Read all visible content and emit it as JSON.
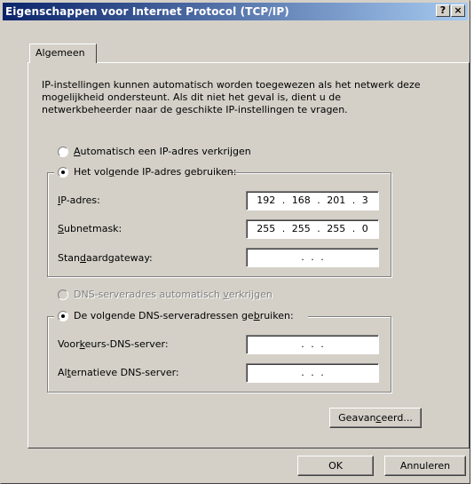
{
  "window": {
    "title": "Eigenschappen voor Internet Protocol (TCP/IP)",
    "help_button": "?",
    "close_button": "×"
  },
  "tabs": [
    {
      "label": "Algemeen",
      "selected": true
    }
  ],
  "description": "IP-instellingen kunnen automatisch worden toegewezen als het netwerk deze mogelijkheid ondersteunt. Als dit niet het geval is, dient u de netwerkbeheerder naar de geschikte IP-instellingen te vragen.",
  "ip_section": {
    "auto_option": {
      "label_pre": "",
      "label_key": "A",
      "label_post": "utomatisch een IP-adres verkrijgen",
      "selected": false
    },
    "manual_option": {
      "label_pre": "Het vol",
      "label_key": "g",
      "label_post": "ende IP-adres gebruiken:",
      "selected": true
    },
    "fields": [
      {
        "label_pre": "",
        "label_key": "I",
        "label_post": "P-adres:",
        "value": "192 . 168 . 201 .  3"
      },
      {
        "label_pre": "",
        "label_key": "S",
        "label_post": "ubnetmask:",
        "value": "255 . 255 . 255 .  0"
      },
      {
        "label_pre": "Stan",
        "label_key": "d",
        "label_post": "aardgateway:",
        "value": ".       .       ."
      }
    ]
  },
  "dns_section": {
    "auto_option": {
      "label_pre": "DNS-serveradres automatisch ",
      "label_key": "v",
      "label_post": "erkrijgen",
      "selected": false,
      "disabled": true
    },
    "manual_option": {
      "label_pre": "De volgende DNS-serveradressen ge",
      "label_key": "b",
      "label_post": "ruiken:",
      "selected": true
    },
    "fields": [
      {
        "label_pre": "Voor",
        "label_key": "k",
        "label_post": "eurs-DNS-server:",
        "value": ".       .       ."
      },
      {
        "label_pre": "Al",
        "label_key": "t",
        "label_post": "ernatieve DNS-server:",
        "value": ".       .       ."
      }
    ]
  },
  "buttons": {
    "advanced": {
      "pre": "Geavan",
      "key": "c",
      "post": "eerd..."
    },
    "ok": "OK",
    "cancel": "Annuleren"
  }
}
